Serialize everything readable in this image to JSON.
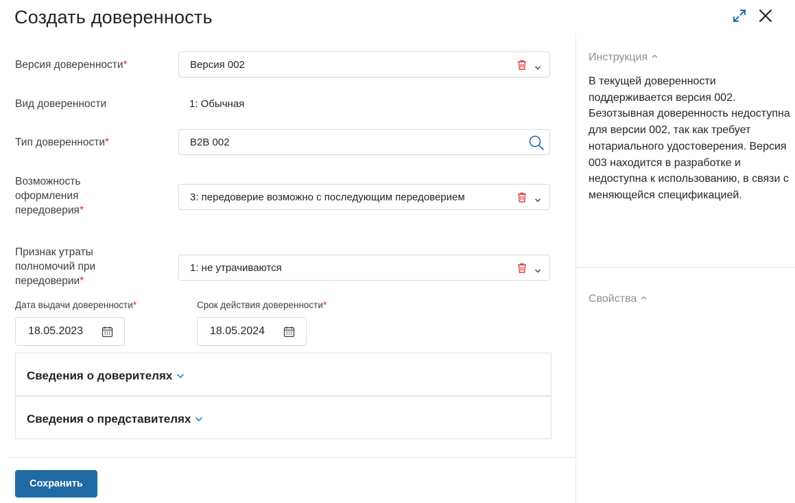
{
  "header": {
    "title": "Создать доверенность"
  },
  "form": {
    "version": {
      "label": "Версия доверенности",
      "value": "Версия 002"
    },
    "kind": {
      "label": "Вид доверенности",
      "value": "1: Обычная"
    },
    "type": {
      "label": "Тип доверенности",
      "value": "B2B 002"
    },
    "redelegation": {
      "label_lines": [
        "Возможность",
        "оформления",
        "передоверия"
      ],
      "value": "3: передоверие возможно с последующим передоверием"
    },
    "loss": {
      "label_lines": [
        "Признак утраты",
        "полномочий при",
        "передоверии"
      ],
      "value": "1: не утрачиваются"
    },
    "issue_date": {
      "label": "Дата выдачи доверенности",
      "value": "18.05.2023"
    },
    "expiry_date": {
      "label": "Срок действия доверенности",
      "value": "18.05.2024"
    },
    "required_mark": "*"
  },
  "sections": [
    {
      "title": "Сведения о доверителях"
    },
    {
      "title": "Сведения о представителях"
    }
  ],
  "footer": {
    "save_label": "Сохранить"
  },
  "sidebar": {
    "instruction": {
      "title": "Инструкция",
      "text": "В текущей доверенности поддерживается версия 002. Безотзывная доверенность недоступна для версии 002, так как требует нотариального удостоверения. Версия 003 находится в разработке и недоступна к использованию, в связи с меняющейся спецификацией."
    },
    "properties": {
      "title": "Свойства"
    }
  },
  "colors": {
    "accent": "#1f6aa5",
    "required": "#d9262c",
    "delete": "#e0393e"
  },
  "icons": [
    "expand-icon",
    "close-icon",
    "trash-icon",
    "chevron-down-icon",
    "search-icon",
    "calendar-icon",
    "chevron-up-icon"
  ]
}
